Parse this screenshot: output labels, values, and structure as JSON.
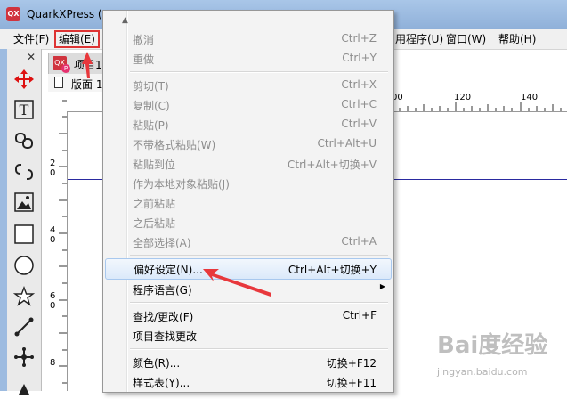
{
  "window": {
    "title": "QuarkXPress (F",
    "app_icon": "QX"
  },
  "menubar": {
    "items": [
      {
        "label": "文件(F)"
      },
      {
        "label": "编辑(E)"
      },
      {
        "label": "用程序(U)"
      },
      {
        "label": "窗口(W)"
      },
      {
        "label": "帮助(H)"
      }
    ]
  },
  "toolbox": {
    "close_glyph": "✕",
    "tools": [
      "move-tool-icon",
      "text-tool-icon",
      "link-tool-icon",
      "unlink-tool-icon",
      "picture-box-icon",
      "rectangle-tool-icon",
      "oval-tool-icon",
      "star-tool-icon",
      "line-tool-icon",
      "bezier-point-icon",
      "pen-tool-icon"
    ]
  },
  "document": {
    "tab_label": "项目1",
    "tab_icon": "QX",
    "tab_badge": "P",
    "layout_label": "版面 1"
  },
  "rulers": {
    "horizontal": [
      "00",
      "120",
      "140"
    ],
    "vertical": [
      [
        "2",
        "0"
      ],
      [
        "4",
        "0"
      ],
      [
        "6",
        "0"
      ],
      [
        "8"
      ]
    ]
  },
  "edit_menu": {
    "top_arrow": "▲",
    "items": [
      {
        "label": "撤消",
        "shortcut": "Ctrl+Z",
        "disabled": true
      },
      {
        "label": "重做",
        "shortcut": "Ctrl+Y",
        "disabled": true
      },
      {
        "label": "剪切(T)",
        "shortcut": "Ctrl+X",
        "disabled": true
      },
      {
        "label": "复制(C)",
        "shortcut": "Ctrl+C",
        "disabled": true
      },
      {
        "label": "粘贴(P)",
        "shortcut": "Ctrl+V",
        "disabled": true
      },
      {
        "label": "不带格式粘贴(W)",
        "shortcut": "Ctrl+Alt+U",
        "disabled": true
      },
      {
        "label": "粘贴到位",
        "shortcut": "Ctrl+Alt+切换+V",
        "disabled": true
      },
      {
        "label": "作为本地对象粘贴(J)",
        "shortcut": "",
        "disabled": true
      },
      {
        "label": "之前粘贴",
        "shortcut": "",
        "disabled": true
      },
      {
        "label": "之后粘贴",
        "shortcut": "",
        "disabled": true
      },
      {
        "label": "全部选择(A)",
        "shortcut": "Ctrl+A",
        "disabled": true
      },
      {
        "label": "偏好设定(N)...",
        "shortcut": "Ctrl+Alt+切换+Y",
        "disabled": false,
        "highlighted": true
      },
      {
        "label": "程序语言(G)",
        "shortcut": "",
        "submenu": "▶",
        "disabled": false
      },
      {
        "label": "查找/更改(F)",
        "shortcut": "Ctrl+F",
        "disabled": false
      },
      {
        "label": "项目查找更改",
        "shortcut": "",
        "disabled": false
      },
      {
        "label": "颜色(R)...",
        "shortcut": "切换+F12",
        "disabled": false
      },
      {
        "label": "样式表(Y)...",
        "shortcut": "切换+F11",
        "disabled": false
      }
    ]
  },
  "watermark": {
    "logo": "Bai度经验",
    "url": "jingyan.baidu.com"
  },
  "colors": {
    "annotation_red": "#e8383c",
    "highlight_border": "#a8c8ee",
    "disabled_text": "#8d8d8d",
    "guide_line": "#2a2aa0"
  }
}
